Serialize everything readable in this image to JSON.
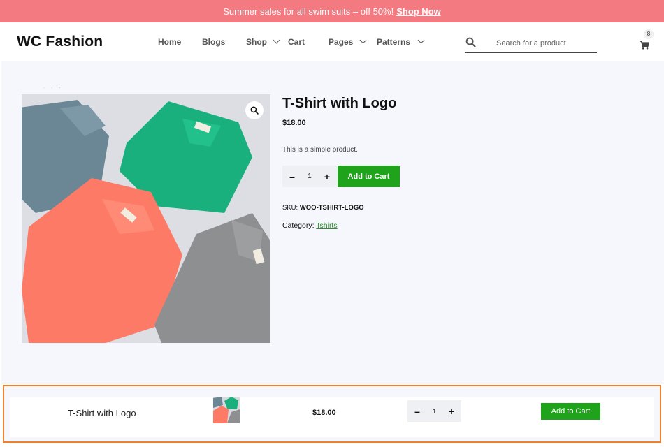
{
  "colors": {
    "announce_bg": "#f27a80",
    "accent_green": "#1ea31b",
    "highlight_border": "#f0812c",
    "link_green": "#2f8f2f"
  },
  "announcement": {
    "text": "Summer sales for all swim suits – off 50%!",
    "link_text": "Shop Now"
  },
  "header": {
    "logo": "WC Fashion",
    "nav": [
      {
        "label": "Home",
        "dropdown": false
      },
      {
        "label": "Blogs",
        "dropdown": false
      },
      {
        "label": "Shop",
        "dropdown": true
      },
      {
        "label": "Cart",
        "dropdown": false
      },
      {
        "label": "Pages",
        "dropdown": true
      },
      {
        "label": "Patterns",
        "dropdown": true
      }
    ],
    "search": {
      "placeholder": "Search for a product",
      "icon": "search-icon"
    },
    "cart": {
      "count": "8",
      "icon": "cart-icon"
    }
  },
  "product": {
    "breadcrumb": ". . .",
    "title": "T-Shirt with Logo",
    "price": "$18.00",
    "description": "This is a simple product.",
    "quantity": "1",
    "add_to_cart_label": "Add to Cart",
    "sku_label": "SKU:",
    "sku_value": "WOO-TSHIRT-LOGO",
    "category_label": "Category:",
    "category_value": "Tshirts",
    "zoom_icon": "magnifier-icon"
  },
  "sticky_bar": {
    "title": "T-Shirt with Logo",
    "price": "$18.00",
    "quantity": "1",
    "add_to_cart_label": "Add to Cart"
  }
}
